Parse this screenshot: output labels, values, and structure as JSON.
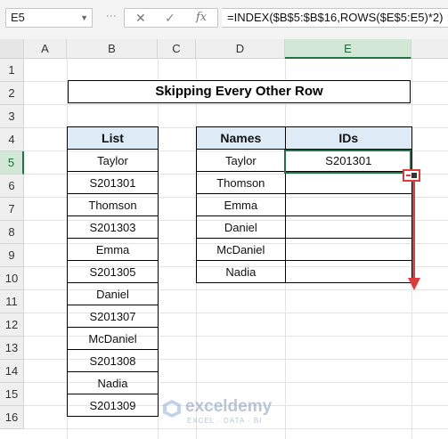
{
  "name_box": "E5",
  "formula_bar": {
    "fx_label": "fx",
    "formula": "=INDEX($B$5:$B$16,ROWS($E$5:E5)*2)"
  },
  "columns": [
    "A",
    "B",
    "C",
    "D",
    "E"
  ],
  "rows": [
    "1",
    "2",
    "3",
    "4",
    "5",
    "6",
    "7",
    "8",
    "9",
    "10",
    "11",
    "12",
    "13",
    "14",
    "15",
    "16"
  ],
  "title": "Skipping Every Other Row",
  "list_table": {
    "header": "List",
    "values": [
      "Taylor",
      "S201301",
      "Thomson",
      "S201303",
      "Emma",
      "S201305",
      "Daniel",
      "S201307",
      "McDaniel",
      "S201308",
      "Nadia",
      "S201309"
    ]
  },
  "names_table": {
    "headers": [
      "Names",
      "IDs"
    ],
    "rows": [
      [
        "Taylor",
        "S201301"
      ],
      [
        "Thomson",
        ""
      ],
      [
        "Emma",
        ""
      ],
      [
        "Daniel",
        ""
      ],
      [
        "McDaniel",
        ""
      ],
      [
        "Nadia",
        ""
      ]
    ]
  },
  "watermark": {
    "name": "exceldemy",
    "tagline": "EXCEL · DATA · BI"
  },
  "colors": {
    "header_fill": "#ddebf7",
    "selection": "#217346",
    "annotation": "#e03b3b"
  }
}
